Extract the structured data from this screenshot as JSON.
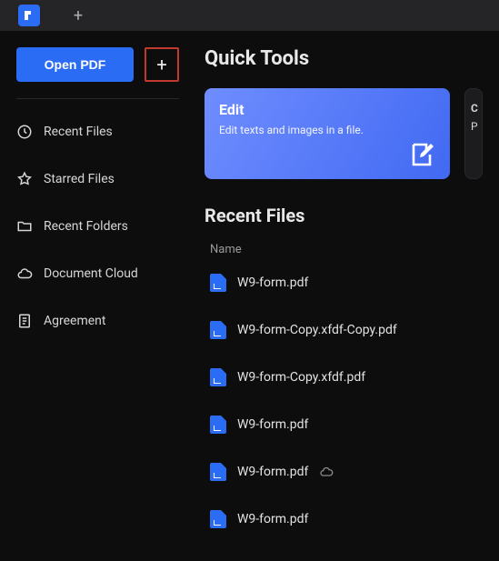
{
  "open_button": "Open PDF",
  "sidebar": {
    "items": [
      {
        "label": "Recent Files"
      },
      {
        "label": "Starred Files"
      },
      {
        "label": "Recent Folders"
      },
      {
        "label": "Document Cloud"
      },
      {
        "label": "Agreement"
      }
    ]
  },
  "quick_tools": {
    "title": "Quick Tools",
    "edit_card": {
      "title": "Edit",
      "desc": "Edit texts and images in a file."
    },
    "peek_card": {
      "line1": "C",
      "line2": "P"
    }
  },
  "recent_files": {
    "title": "Recent Files",
    "col_head": "Name",
    "files": [
      {
        "name": "W9-form.pdf",
        "cloud": false
      },
      {
        "name": "W9-form-Copy.xfdf-Copy.pdf",
        "cloud": false
      },
      {
        "name": "W9-form-Copy.xfdf.pdf",
        "cloud": false
      },
      {
        "name": "W9-form.pdf",
        "cloud": false
      },
      {
        "name": "W9-form.pdf",
        "cloud": true
      },
      {
        "name": "W9-form.pdf",
        "cloud": false
      }
    ]
  }
}
